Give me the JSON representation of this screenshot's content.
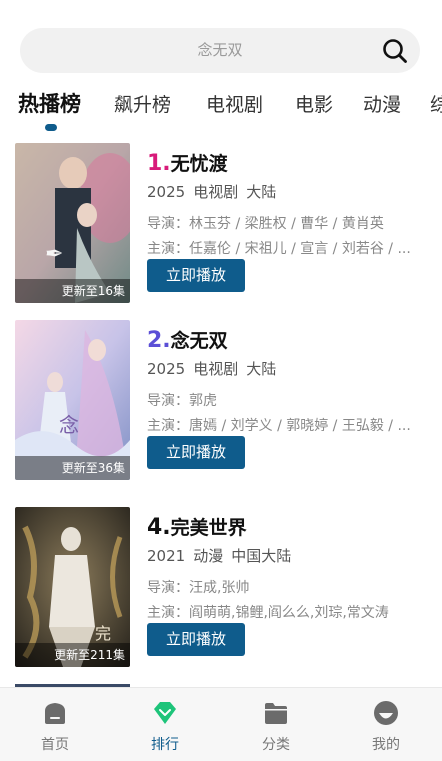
{
  "search": {
    "placeholder": "念无双"
  },
  "tabs": [
    {
      "label": "热播榜"
    },
    {
      "label": "飙升榜"
    },
    {
      "label": "电视剧"
    },
    {
      "label": "电影"
    },
    {
      "label": "动漫"
    },
    {
      "label": "综"
    }
  ],
  "items": [
    {
      "rank": "1.",
      "rank_color": "#d81b7a",
      "title": "无忧渡",
      "year": "2025",
      "type": "电视剧",
      "region": "大陆",
      "director": "导演：林玉芬 / 梁胜权 / 曹华 / 黄肖英",
      "cast": "主演：任嘉伦 / 宋祖儿 / 宣言 / 刘若谷 / ...",
      "update": "更新至16集",
      "play_label": "立即播放"
    },
    {
      "rank": "2.",
      "rank_color": "#5b4fd6",
      "title": "念无双",
      "year": "2025",
      "type": "电视剧",
      "region": "大陆",
      "director": "导演：郭虎",
      "cast": "主演：唐嫣 / 刘学义 / 郭晓婷 / 王弘毅 / ...",
      "update": "更新至36集",
      "play_label": "立即播放"
    },
    {
      "rank": "4.",
      "rank_color": "#111111",
      "title": "完美世界",
      "year": "2021",
      "type": "动漫",
      "region": "中国大陆",
      "director": "导演：汪成,张帅",
      "cast": "主演：阎萌萌,锦鲤,阎么么,刘琮,常文涛",
      "update": "更新至211集",
      "play_label": "立即播放"
    }
  ],
  "nav": [
    {
      "label": "首页",
      "icon": "home-icon"
    },
    {
      "label": "排行",
      "icon": "ranking-gem-icon"
    },
    {
      "label": "分类",
      "icon": "folder-icon"
    },
    {
      "label": "我的",
      "icon": "profile-icon"
    }
  ],
  "colors": {
    "accent": "#0f5c8c",
    "active_nav": "#1ec47a"
  }
}
